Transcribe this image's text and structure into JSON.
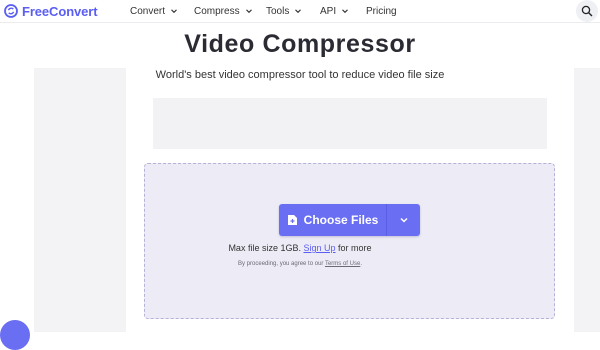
{
  "header": {
    "brand": "FreeConvert",
    "nav": [
      {
        "label": "Convert",
        "has_dropdown": true
      },
      {
        "label": "Compress",
        "has_dropdown": true
      },
      {
        "label": "Tools",
        "has_dropdown": true
      },
      {
        "label": "API",
        "has_dropdown": true
      },
      {
        "label": "Pricing",
        "has_dropdown": false
      }
    ],
    "search_icon": "search-icon"
  },
  "main": {
    "title": "Video Compressor",
    "subtitle": "World's best video compressor tool to reduce video file size"
  },
  "upload": {
    "choose_files_label": "Choose Files",
    "file_icon": "file-plus-icon",
    "dropdown_icon": "chevron-down-icon",
    "max_size_text": "Max file size 1GB.",
    "signup_link": "Sign Up",
    "max_size_suffix": "for more",
    "terms_prefix": "By proceeding, you agree to our",
    "terms_link": "Terms of Use",
    "terms_suffix": "."
  },
  "colors": {
    "brand": "#5b5ef2",
    "button": "#6a6ef2",
    "dropzone_bg": "#edecf6",
    "dropzone_border": "#b4b2d6"
  }
}
